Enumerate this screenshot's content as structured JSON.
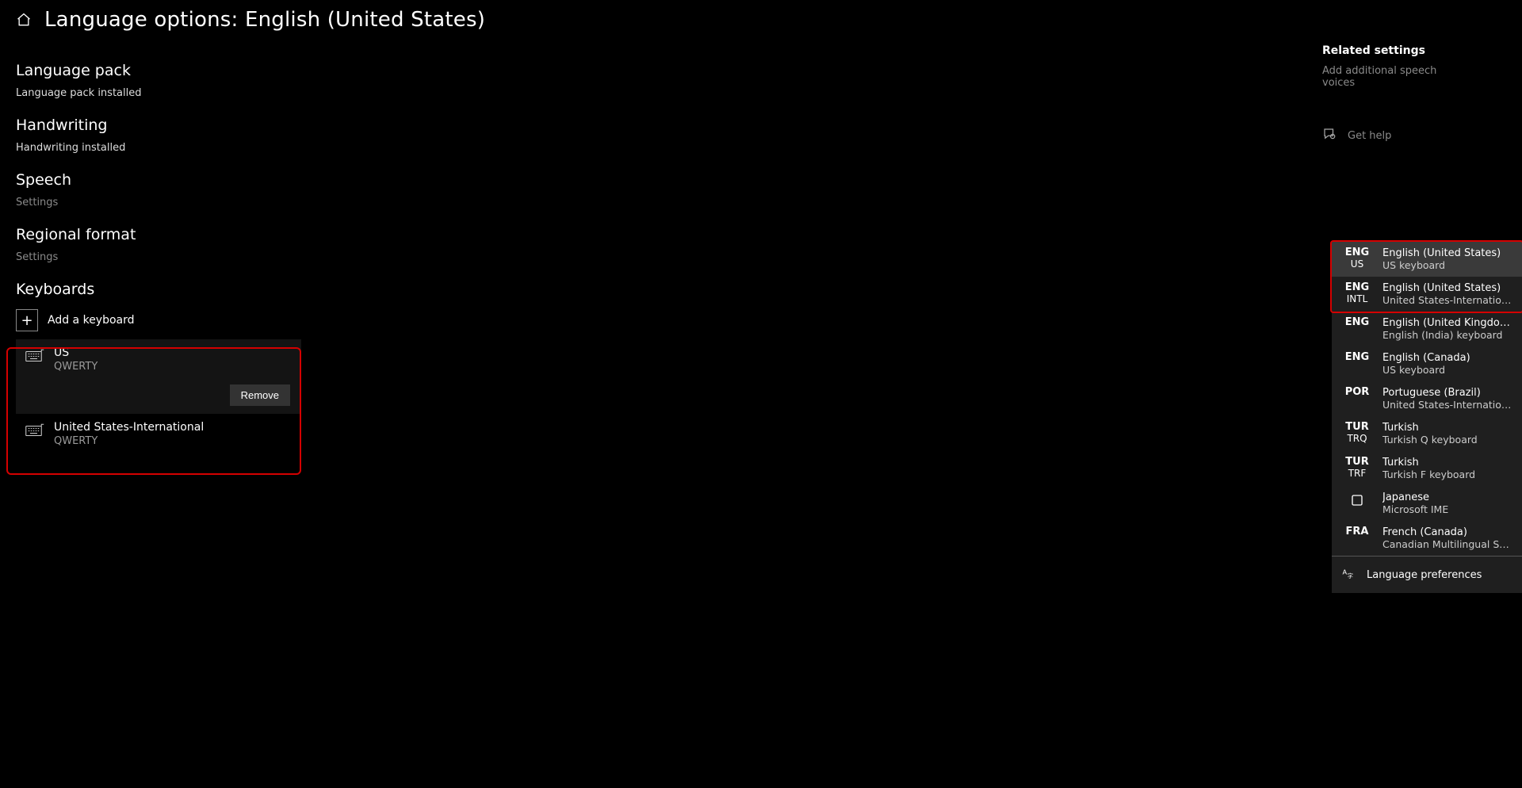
{
  "header": {
    "title": "Language options: English (United States)"
  },
  "sections": {
    "language_pack": {
      "heading": "Language pack",
      "status": "Language pack installed"
    },
    "handwriting": {
      "heading": "Handwriting",
      "status": "Handwriting installed"
    },
    "speech": {
      "heading": "Speech",
      "link": "Settings"
    },
    "regional": {
      "heading": "Regional format",
      "link": "Settings"
    },
    "keyboards": {
      "heading": "Keyboards",
      "add_label": "Add a keyboard"
    }
  },
  "keyboards": [
    {
      "name": "US",
      "sub": "QWERTY",
      "selected": true,
      "remove_label": "Remove"
    },
    {
      "name": "United States-International",
      "sub": "QWERTY",
      "selected": false
    }
  ],
  "sidebar": {
    "heading": "Related settings",
    "link1": "Add additional speech voices",
    "help": "Get help"
  },
  "ime": {
    "items": [
      {
        "tag": "ENG",
        "tag_sub": "US",
        "lang": "English (United States)",
        "kb": "US keyboard",
        "selected": true
      },
      {
        "tag": "ENG",
        "tag_sub": "INTL",
        "lang": "English (United States)",
        "kb": "United States-International k…"
      },
      {
        "tag": "ENG",
        "tag_sub": "",
        "lang": "English (United Kingdom)",
        "kb": "English (India) keyboard"
      },
      {
        "tag": "ENG",
        "tag_sub": "",
        "lang": "English (Canada)",
        "kb": "US keyboard"
      },
      {
        "tag": "POR",
        "tag_sub": "",
        "lang": "Portuguese (Brazil)",
        "kb": "United States-International k…"
      },
      {
        "tag": "TUR",
        "tag_sub": "TRQ",
        "lang": "Turkish",
        "kb": "Turkish Q keyboard"
      },
      {
        "tag": "TUR",
        "tag_sub": "TRF",
        "lang": "Turkish",
        "kb": "Turkish F keyboard"
      },
      {
        "tag": "icon",
        "tag_sub": "",
        "lang": "Japanese",
        "kb": "Microsoft IME"
      },
      {
        "tag": "FRA",
        "tag_sub": "",
        "lang": "French (Canada)",
        "kb": "Canadian Multilingual Stand…"
      }
    ],
    "prefs_label": "Language preferences"
  }
}
